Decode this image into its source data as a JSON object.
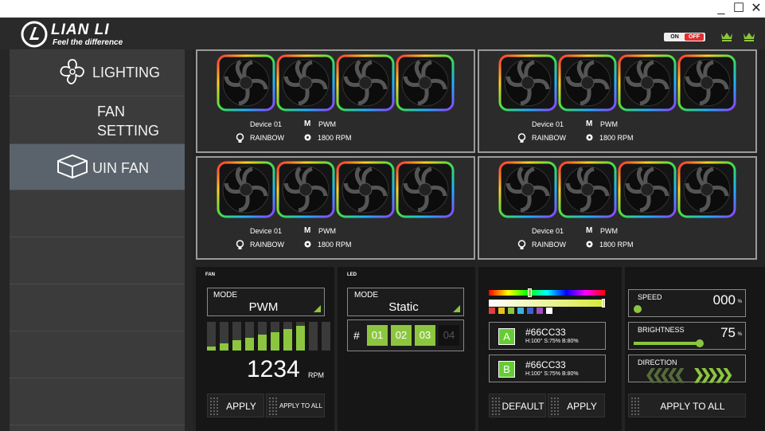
{
  "window": {
    "minimize_glyph": "_",
    "maximize_glyph": "☐",
    "close_glyph": "✕"
  },
  "brand": {
    "name": "LIAN LI",
    "tagline": "Feel the difference"
  },
  "power_toggle": {
    "on": "ON",
    "off": "OFF"
  },
  "sidebar": {
    "items": [
      {
        "label": "LIGHTING",
        "icon": "flower-icon"
      },
      {
        "label": "FAN\nSETTING",
        "icon": "circle-icon"
      },
      {
        "label": "UIN FAN",
        "icon": "box-icon"
      }
    ]
  },
  "devices": [
    {
      "name": "Device 01",
      "mode_key": "M",
      "mode": "PWM",
      "effect": "RAINBOW",
      "rpm": "1800 RPM"
    },
    {
      "name": "Device 01",
      "mode_key": "M",
      "mode": "PWM",
      "effect": "RAINBOW",
      "rpm": "1800 RPM"
    },
    {
      "name": "Device 01",
      "mode_key": "M",
      "mode": "PWM",
      "effect": "RAINBOW",
      "rpm": "1800 RPM"
    },
    {
      "name": "Device 01",
      "mode_key": "M",
      "mode": "PWM",
      "effect": "RAINBOW",
      "rpm": "1800 RPM"
    }
  ],
  "fan_panel": {
    "title": "FAN",
    "mode_label": "MODE",
    "mode_value": "PWM",
    "speed_levels": [
      0.15,
      0.25,
      0.35,
      0.45,
      0.55,
      0.65,
      0.75,
      0.85,
      0,
      0
    ],
    "rpm": "1234",
    "rpm_unit": "RPM",
    "apply": "APPLY",
    "apply_all": "APPLY TO ALL"
  },
  "led_panel": {
    "title": "LED",
    "mode_label": "MODE",
    "mode_value": "Static",
    "hash": "#",
    "slots": [
      "01",
      "02",
      "03",
      "04"
    ],
    "slots_active": 3
  },
  "color_panel": {
    "hue_position": 0.35,
    "swatches": [
      "#e04040",
      "#e8c020",
      "#8cc63f",
      "#40b0e0",
      "#4060d0",
      "#a050c0",
      "#ffffff"
    ],
    "color_a": {
      "letter": "A",
      "hex": "#66CC33",
      "hsb": "H:100° S:75% B:80%",
      "color": "#66cc33"
    },
    "color_b": {
      "letter": "B",
      "hex": "#66CC33",
      "hsb": "H:100° S:75% B:80%",
      "color": "#66cc33"
    },
    "default": "DEFAULT",
    "apply": "APPLY"
  },
  "effect_panel": {
    "speed_label": "SPEED",
    "speed_value": "000",
    "speed_unit": "%",
    "speed_level": 0,
    "brightness_label": "BRIGHTNESS",
    "brightness_value": "75",
    "brightness_unit": "%",
    "brightness_level": 0.75,
    "direction_label": "DIRECTION",
    "left_arrows": "❮❮❮❮❮",
    "right_arrows": "❯❯❯❯❯",
    "apply_all": "APPLY TO ALL"
  },
  "colors": {
    "accent": "#8cc63f",
    "off": "#e03030"
  }
}
